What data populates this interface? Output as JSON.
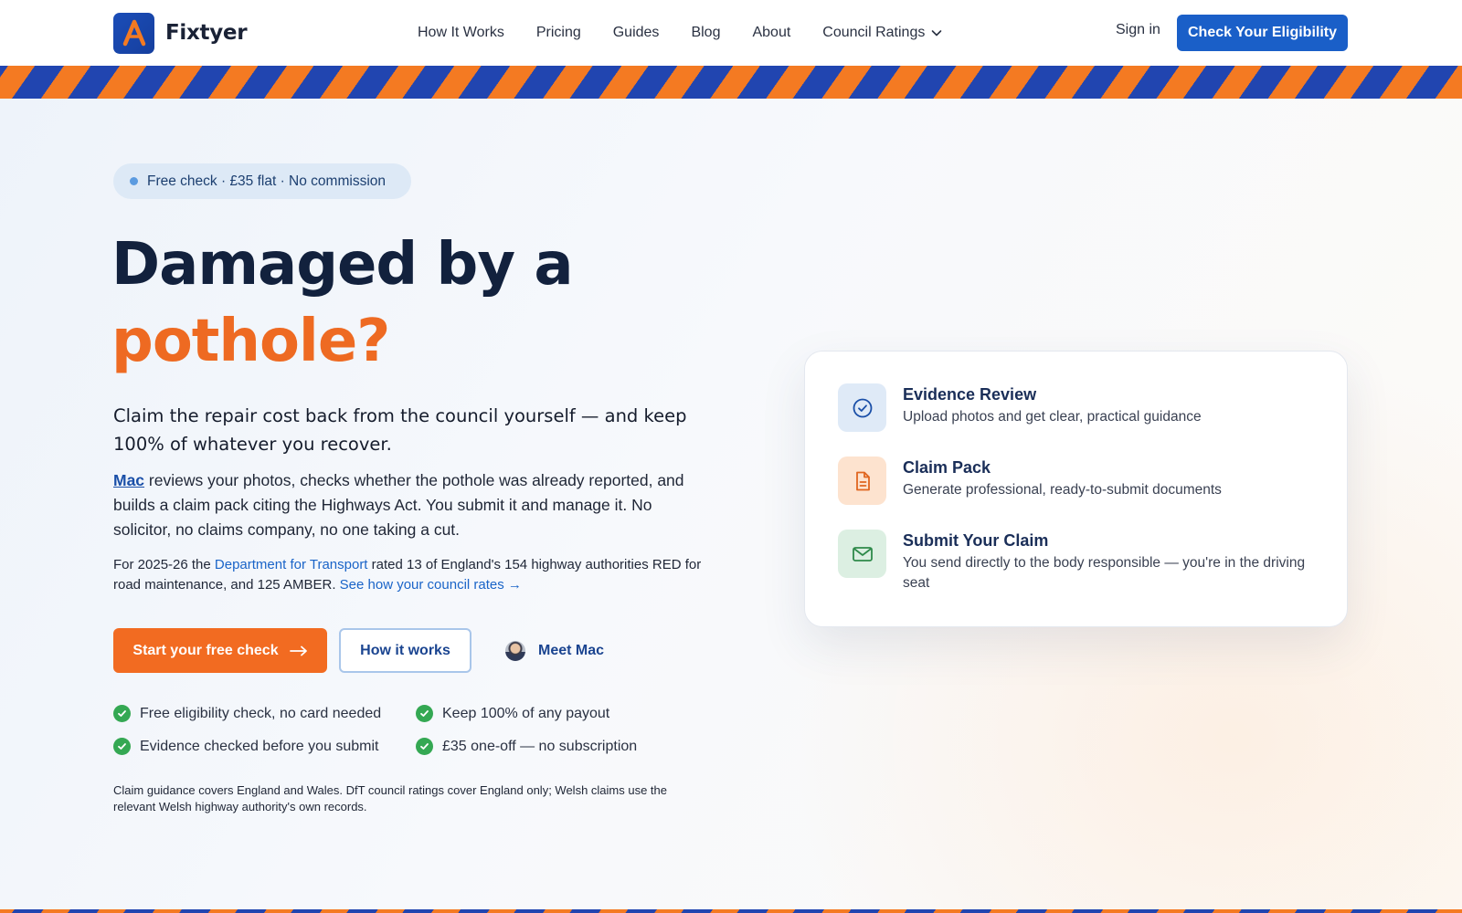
{
  "brand": {
    "name": "Fixtyer"
  },
  "nav": {
    "items": [
      "How It Works",
      "Pricing",
      "Guides",
      "Blog",
      "About",
      "Council Ratings"
    ],
    "signin": "Sign in",
    "cta": "Check Your Eligibility"
  },
  "colors": {
    "primary_blue": "#1a5fc8",
    "accent_orange": "#f26b21",
    "check_green": "#34a853"
  },
  "hero": {
    "pill": "Free check · £35 flat · No commission",
    "headline_line1": "Damaged by a",
    "headline_line2": "pothole?",
    "lede": "Claim the repair cost back from the council yourself — and keep 100% of whatever you recover.",
    "body_link": "Mac",
    "body_rest": " reviews your photos, checks whether the pothole was already reported, and builds a claim pack citing the Highways Act. You submit it and manage it. No solicitor, no claims company, no one taking a cut.",
    "stat_prefix": "For 2025-26 the ",
    "stat_link": "Department for Transport",
    "stat_middle": " rated 13 of England's 154 highway authorities RED for road maintenance, and 125 AMBER. ",
    "stat_link2": "See how your council rates →",
    "btn_start": "Start your free check",
    "btn_how": "How it works",
    "meet": "Meet Mac",
    "checks": [
      "Free eligibility check, no card needed",
      "Keep 100% of any payout",
      "Evidence checked before you submit",
      "£35 one-off — no subscription"
    ],
    "disclaimer": "Claim guidance covers England and Wales. DfT council ratings cover England only; Welsh claims use the relevant Welsh highway authority's own records."
  },
  "features": [
    {
      "icon": "check-circle-icon",
      "title": "Evidence Review",
      "desc": "Upload photos and get clear, practical guidance"
    },
    {
      "icon": "document-icon",
      "title": "Claim Pack",
      "desc": "Generate professional, ready-to-submit documents"
    },
    {
      "icon": "mail-icon",
      "title": "Submit Your Claim",
      "desc": "You send directly to the body responsible — you're in the driving seat"
    }
  ]
}
